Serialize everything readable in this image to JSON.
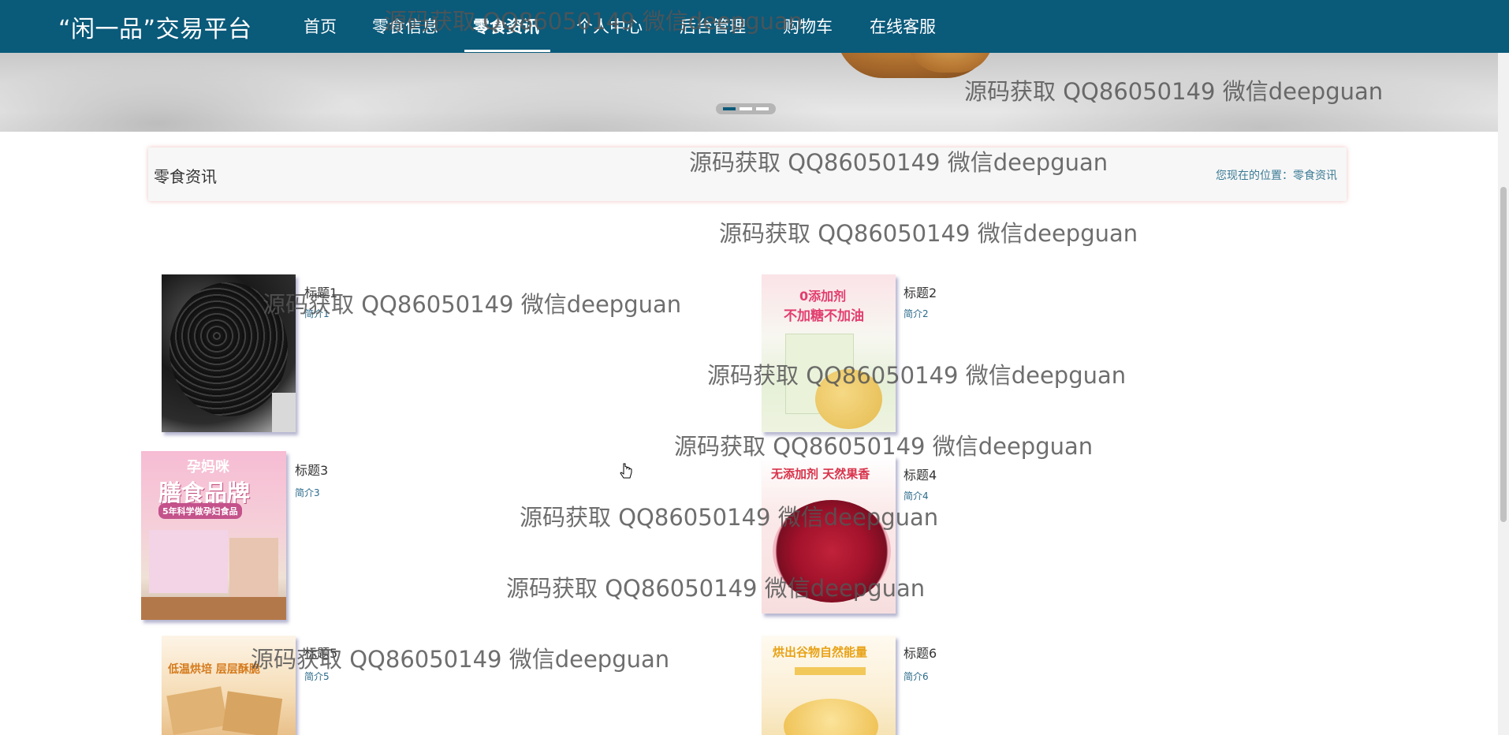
{
  "nav": {
    "brand": "“闲一品”交易平台",
    "items": [
      {
        "label": "首页"
      },
      {
        "label": "零食信息"
      },
      {
        "label": "零食资讯",
        "active": true
      },
      {
        "label": "个人中心"
      },
      {
        "label": "后台管理"
      },
      {
        "label": "购物车"
      },
      {
        "label": "在线客服"
      }
    ]
  },
  "banner": {
    "active_slide": 1,
    "slide_count": 3
  },
  "section": {
    "title": "零食资讯",
    "breadcrumb": "您现在的位置：零食资讯"
  },
  "news": [
    {
      "title": "标题1",
      "intro": "简介1"
    },
    {
      "title": "标题2",
      "intro": "简介2",
      "image_text": [
        "0添加剂",
        "不加糖不加油"
      ]
    },
    {
      "title": "标题3",
      "intro": "简介3",
      "image_text": [
        "孕妈咪",
        "膳食品牌",
        "5年科学做孕妇食品"
      ]
    },
    {
      "title": "标题4",
      "intro": "简介4",
      "image_text": [
        "无添加剂 天然果香"
      ]
    },
    {
      "title": "标题5",
      "intro": "简介5",
      "image_text": [
        "低温烘培 层层酥脆"
      ]
    },
    {
      "title": "标题6",
      "intro": "简介6",
      "image_text": [
        "烘出谷物自然能量"
      ]
    }
  ],
  "watermark": "源码获取 QQ86050149 微信deepguan"
}
